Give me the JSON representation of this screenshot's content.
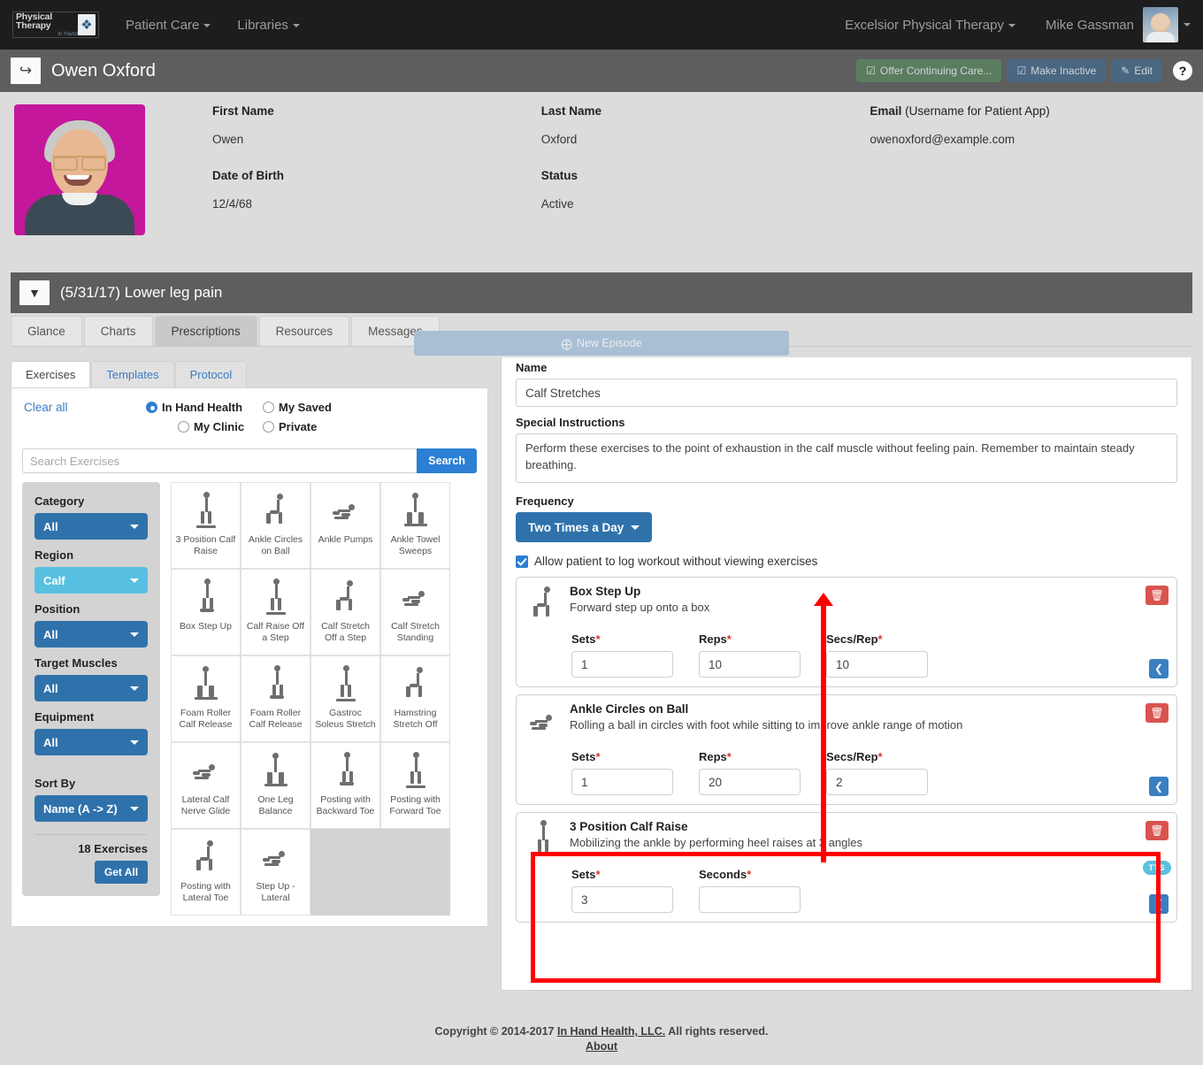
{
  "topnav": {
    "logo_line1": "Physical Therapy",
    "logo_line2": "In Hand",
    "logo_mark": "hand-logo-icon",
    "items": [
      {
        "label": "Patient Care"
      },
      {
        "label": "Libraries"
      }
    ],
    "clinic": "Excelsior Physical Therapy",
    "user": "Mike Gassman"
  },
  "patient_bar": {
    "back_icon": "back-arrow-icon",
    "name": "Owen Oxford",
    "buttons": [
      {
        "label": "Offer Continuing Care...",
        "icon": "check-square-icon"
      },
      {
        "label": "Make Inactive",
        "icon": "check-square-icon"
      },
      {
        "label": "Edit",
        "icon": "edit-square-icon"
      }
    ],
    "help_label": "?"
  },
  "patient_info": {
    "first_name_label": "First Name",
    "first_name_value": "Owen",
    "last_name_label": "Last Name",
    "last_name_value": "Oxford",
    "email_label": "Email",
    "email_label_soft": " (Username for Patient App)",
    "email_value": "owenoxford@example.com",
    "dob_label": "Date of Birth",
    "dob_value": "12/4/68",
    "status_label": "Status",
    "status_value": "Active",
    "new_episode_label": "New Episode"
  },
  "episode": {
    "title": "(5/31/17) Lower leg pain",
    "toggle_icon": "chevron-down-icon"
  },
  "tabs": [
    {
      "label": "Glance",
      "active": false
    },
    {
      "label": "Charts",
      "active": false
    },
    {
      "label": "Prescriptions",
      "active": true
    },
    {
      "label": "Resources",
      "active": false
    },
    {
      "label": "Messages",
      "active": false
    }
  ],
  "library": {
    "inner_tabs": [
      {
        "label": "Exercises",
        "active": true
      },
      {
        "label": "Templates",
        "active": false
      },
      {
        "label": "Protocol",
        "active": false
      }
    ],
    "clear_all": "Clear all",
    "radios": [
      {
        "label": "In Hand Health",
        "selected": true
      },
      {
        "label": "My Saved",
        "selected": false
      },
      {
        "label": "My Clinic",
        "selected": false
      },
      {
        "label": "Private",
        "selected": false
      }
    ],
    "search_placeholder": "Search Exercises",
    "search_value": "",
    "search_button": "Search",
    "filters": [
      {
        "label": "Category",
        "value": "All",
        "highlighted": false
      },
      {
        "label": "Region",
        "value": "Calf",
        "highlighted": true
      },
      {
        "label": "Position",
        "value": "All",
        "highlighted": false
      },
      {
        "label": "Target Muscles",
        "value": "All",
        "highlighted": false
      },
      {
        "label": "Equipment",
        "value": "All",
        "highlighted": false
      }
    ],
    "sort_label": "Sort By",
    "sort_value": "Name (A -> Z)",
    "count_text": "18 Exercises",
    "get_all_label": "Get All",
    "exercises": [
      {
        "name": "3 Position Calf Raise"
      },
      {
        "name": "Ankle Circles on Ball"
      },
      {
        "name": "Ankle Pumps"
      },
      {
        "name": "Ankle Towel Sweeps"
      },
      {
        "name": "Box Step Up"
      },
      {
        "name": "Calf Raise Off a Step"
      },
      {
        "name": "Calf Stretch Off a Step"
      },
      {
        "name": "Calf Stretch Standing"
      },
      {
        "name": "Foam Roller Calf Release"
      },
      {
        "name": "Foam Roller Calf Release"
      },
      {
        "name": "Gastroc Soleus Stretch"
      },
      {
        "name": "Hamstring Stretch Off"
      },
      {
        "name": "Lateral Calf Nerve Glide"
      },
      {
        "name": "One Leg Balance"
      },
      {
        "name": "Posting with Backward Toe"
      },
      {
        "name": "Posting with Forward Toe"
      },
      {
        "name": "Posting with Lateral Toe"
      },
      {
        "name": "Step Up - Lateral"
      }
    ]
  },
  "prescription": {
    "name_label": "Name",
    "name_value": "Calf Stretches",
    "instructions_label": "Special Instructions",
    "instructions_value": "Perform these exercises to the point of exhaustion in the calf muscle without feeling pain. Remember to maintain steady breathing.",
    "frequency_label": "Frequency",
    "frequency_value": "Two Times a Day",
    "allow_log_label": "Allow patient to log workout without viewing exercises",
    "allow_log_checked": true,
    "items": [
      {
        "title": "Box Step Up",
        "description": "Forward step up onto a box",
        "fields": [
          {
            "label": "Sets",
            "required": true,
            "value": "1"
          },
          {
            "label": "Reps",
            "required": true,
            "value": "10"
          },
          {
            "label": "Secs/Rep",
            "required": true,
            "value": "10"
          }
        ],
        "tts": false,
        "highlighted": false
      },
      {
        "title": "Ankle Circles on Ball",
        "description": "Rolling a ball in circles with foot while sitting to improve ankle range of motion",
        "fields": [
          {
            "label": "Sets",
            "required": true,
            "value": "1"
          },
          {
            "label": "Reps",
            "required": true,
            "value": "20"
          },
          {
            "label": "Secs/Rep",
            "required": true,
            "value": "2"
          }
        ],
        "tts": false,
        "highlighted": false
      },
      {
        "title": "3 Position Calf Raise",
        "description": "Mobilizing the ankle by performing heel raises at 3 angles",
        "fields": [
          {
            "label": "Sets",
            "required": true,
            "value": "3"
          },
          {
            "label": "Seconds",
            "required": true,
            "value": ""
          }
        ],
        "tts": true,
        "tts_label": "TTS",
        "highlighted": true
      }
    ],
    "delete_icon": "trash-icon",
    "collapse_icon": "chevron-left-icon"
  },
  "annotation": {
    "arrow_color": "#fe0000",
    "box_color": "#fe0000"
  },
  "footer": {
    "copyright_prefix": "Copyright © 2014-2017 ",
    "company": "In Hand Health, LLC.",
    "copyright_suffix": " All rights reserved.",
    "about": "About"
  }
}
